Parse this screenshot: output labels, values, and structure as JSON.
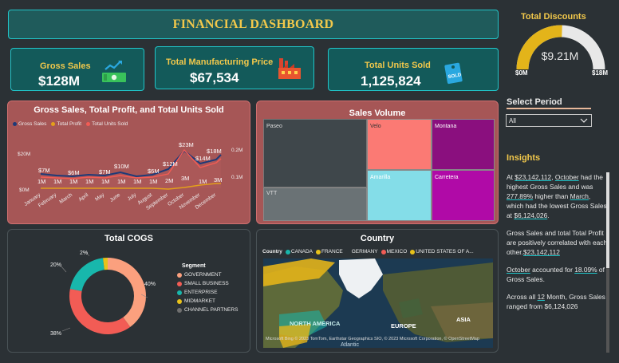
{
  "header": {
    "title": "FINANCIAL DASHBOARD"
  },
  "kpis": {
    "gross_sales": {
      "label": "Gross Sales",
      "value": "$128M"
    },
    "manufacturing": {
      "label": "Total Manufacturing Price",
      "value": "$67,534"
    },
    "units_sold": {
      "label": "Total Units Sold",
      "value": "1,125,824"
    }
  },
  "discounts": {
    "title": "Total Discounts",
    "value": "$9.21M",
    "min": "$0M",
    "max": "$18M",
    "fraction": 0.51
  },
  "period": {
    "label": "Select Period",
    "selected": "All"
  },
  "line_chart": {
    "title": "Gross Sales, Total Profit, and Total Units Sold",
    "legend": [
      "Gross Sales",
      "Total Profit",
      "Total Units Sold"
    ],
    "y_left_ticks": [
      "$20M",
      "$0M"
    ],
    "y_right_ticks": [
      "0.2M",
      "0.1M"
    ],
    "month_labels": [
      "January",
      "February",
      "March",
      "April",
      "May",
      "June",
      "July",
      "August",
      "September",
      "October",
      "November",
      "December"
    ],
    "sales_labels": [
      "$7M",
      "$6M",
      "$7M",
      "$10M",
      "$6M",
      "$12M",
      "$23M",
      "$14M",
      "$18M"
    ],
    "units_labels": [
      "1M",
      "1M",
      "1M",
      "1M",
      "1M",
      "1M",
      "1M",
      "1M",
      "2M",
      "3M",
      "1M",
      "3M"
    ]
  },
  "treemap": {
    "title": "Sales Volume",
    "items": [
      "Paseo",
      "VTT",
      "Velo",
      "Montana",
      "Amarilla",
      "Carretera"
    ],
    "colors": {
      "paseo": "#3f474b",
      "vtt": "#6a7275",
      "velo": "#fb7a74",
      "montana": "#8a0f7e",
      "amarilla": "#84dde8",
      "carretera": "#b00aa7"
    }
  },
  "insights": {
    "title": "Insights",
    "p1_a": "At ",
    "p1_b": "$23,142,112",
    "p1_c": ", ",
    "p1_d": "October",
    "p1_e": " had the highest Gross Sales and was ",
    "p1_f": "277.89%",
    "p1_g": " higher than ",
    "p1_h": "March",
    "p1_i": ", which had the lowest Gross Sales at ",
    "p1_j": "$6,124,026",
    "p1_k": ".",
    "p2_a": "Gross Sales and total Total Profit are positively correlated with each other.",
    "p2_b": "$23,142,112",
    "p3_a": "October",
    "p3_b": " accounted for ",
    "p3_c": "18.09%",
    "p3_d": " of Gross Sales.",
    "p4_a": "Across all ",
    "p4_b": "12",
    "p4_c": " Month, Gross Sales ranged from $6,124,026"
  },
  "cogs": {
    "title": "Total COGS",
    "legend_title": "Segment",
    "segments": [
      "GOVERNMENT",
      "SMALL BUSINESS",
      "ENTERPRISE",
      "MIDMARKET",
      "CHANNEL PARTNERS"
    ],
    "percents": [
      "40%",
      "38%",
      "20%",
      "2%"
    ],
    "colors": [
      "#fba07e",
      "#f25c55",
      "#18b7ac",
      "#e8c21a",
      "#6f6f6f"
    ]
  },
  "map": {
    "title": "Country",
    "legend_label": "Country",
    "countries": [
      "CANADA",
      "FRANCE",
      "GERMANY",
      "MEXICO",
      "UNITED STATES OF A..."
    ],
    "country_colors": [
      "#18b7ac",
      "#e8c21a",
      "#2b3135",
      "#f25c55",
      "#e8c21a"
    ],
    "labels": {
      "na": "NORTH AMERICA",
      "europe": "EUROPE",
      "asia": "ASIA",
      "atlantic": "Atlantic"
    },
    "attribution": "Microsoft Bing  © 2023 TomTom, Earthstar Geographics SIO, © 2023 Microsoft Corporation, © OpenStreetMap"
  }
}
